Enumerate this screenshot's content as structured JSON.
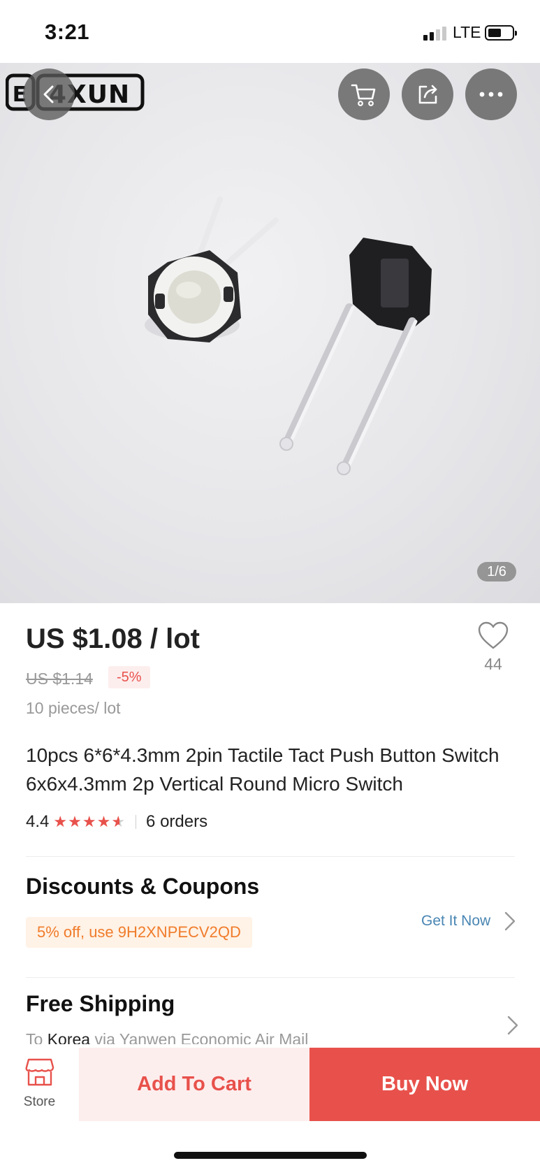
{
  "status_bar": {
    "time": "3:21",
    "network": "LTE"
  },
  "gallery": {
    "brand_logo": "EYXUN",
    "pager": "1/6",
    "icons": [
      "back-arrow-icon",
      "cart-icon",
      "share-icon",
      "more-icon"
    ]
  },
  "product": {
    "price": "US $1.08 / lot",
    "original_price": "US $1.14",
    "discount": "-5%",
    "unit": "10 pieces/ lot",
    "title": "10pcs 6*6*4.3mm 2pin Tactile Tact Push Button Switch 6x6x4.3mm 2p Vertical Round Micro Switch",
    "rating": "4.4",
    "rating_value": 4.4,
    "orders": "6 orders",
    "wishlist_count": "44"
  },
  "discounts": {
    "title": "Discounts & Coupons",
    "coupon": "5% off, use 9H2XNPECV2QD",
    "action": "Get It Now"
  },
  "shipping": {
    "title": "Free Shipping",
    "prefix": "To",
    "destination": "Korea",
    "method": "via Yanwen Economic Air Mail"
  },
  "bottom_bar": {
    "store_label": "Store",
    "add_to_cart": "Add To Cart",
    "buy_now": "Buy Now"
  },
  "colors": {
    "accent": "#e8514b",
    "coupon_text": "#f07c2b",
    "link": "#4a86b3"
  }
}
